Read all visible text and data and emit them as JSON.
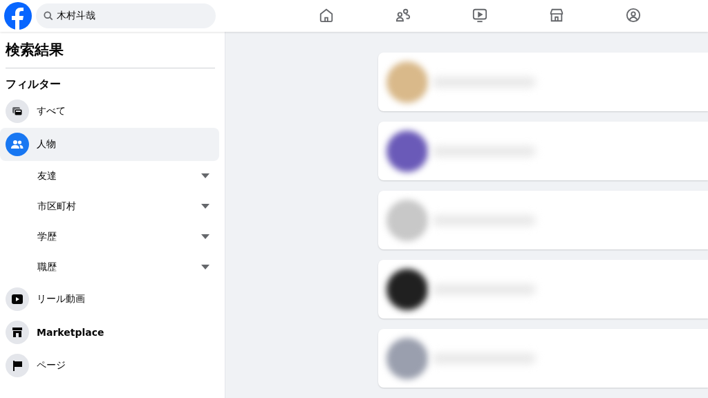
{
  "search": {
    "value": "木村斗哉"
  },
  "nav_items": [
    {
      "selected": false
    },
    {
      "selected": false
    },
    {
      "selected": false
    },
    {
      "selected": false
    },
    {
      "selected": false
    }
  ],
  "sidebar": {
    "title": "検索結果",
    "filter_heading": "フィルター",
    "items": [
      {
        "kind": "category",
        "label": "すべて",
        "selected": false
      },
      {
        "kind": "category",
        "label": "人物",
        "selected": true
      },
      {
        "kind": "sub",
        "label": "友達"
      },
      {
        "kind": "sub",
        "label": "市区町村"
      },
      {
        "kind": "sub",
        "label": "学歴"
      },
      {
        "kind": "sub",
        "label": "職歴"
      },
      {
        "kind": "category",
        "label": "リール動画",
        "selected": false
      },
      {
        "kind": "category",
        "label": "Marketplace",
        "selected": false
      },
      {
        "kind": "category",
        "label": "ページ",
        "selected": false
      }
    ]
  },
  "results": [
    {
      "color": "#d9b98a"
    },
    {
      "color": "#6a5ab8"
    },
    {
      "color": "#c8c8c8"
    },
    {
      "color": "#202020"
    },
    {
      "color": "#9a9fae"
    }
  ]
}
